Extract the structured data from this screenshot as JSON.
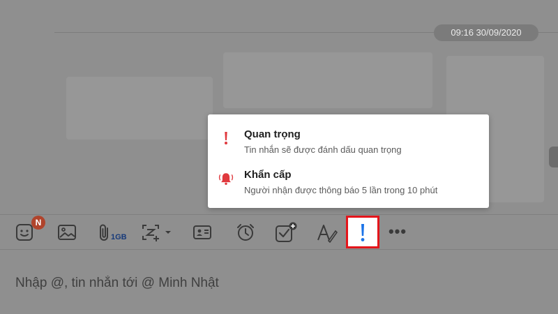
{
  "chat": {
    "date_stamp": "09:16 30/09/2020"
  },
  "toolbar": {
    "sticker_badge": "N",
    "attachment_size": "1GB",
    "items": [
      {
        "name": "sticker-icon"
      },
      {
        "name": "image-icon"
      },
      {
        "name": "paperclip-icon"
      },
      {
        "name": "screenshot-icon"
      },
      {
        "name": "contact-card-icon"
      },
      {
        "name": "alarm-clock-icon"
      },
      {
        "name": "task-checkbox-icon"
      },
      {
        "name": "text-format-icon"
      },
      {
        "name": "exclamation-icon"
      },
      {
        "name": "more-dots-icon"
      }
    ],
    "more_label": "•••"
  },
  "priority_menu": {
    "items": [
      {
        "icon": "exclamation-icon",
        "title": "Quan trọng",
        "description": "Tin nhắn sẽ được đánh dấu quan trọng"
      },
      {
        "icon": "bell-icon",
        "title": "Khẩn cấp",
        "description": "Người nhận được thông báo 5 lần trong 10 phút"
      }
    ]
  },
  "composer": {
    "placeholder": "Nhập @, tin nhắn tới @ Minh Nhật"
  },
  "colors": {
    "accent": "#1a73e8",
    "alert_red": "#e0393e",
    "highlight_border": "#e4151b",
    "badge": "#b0442c",
    "overlay": "#8f8f8f"
  }
}
